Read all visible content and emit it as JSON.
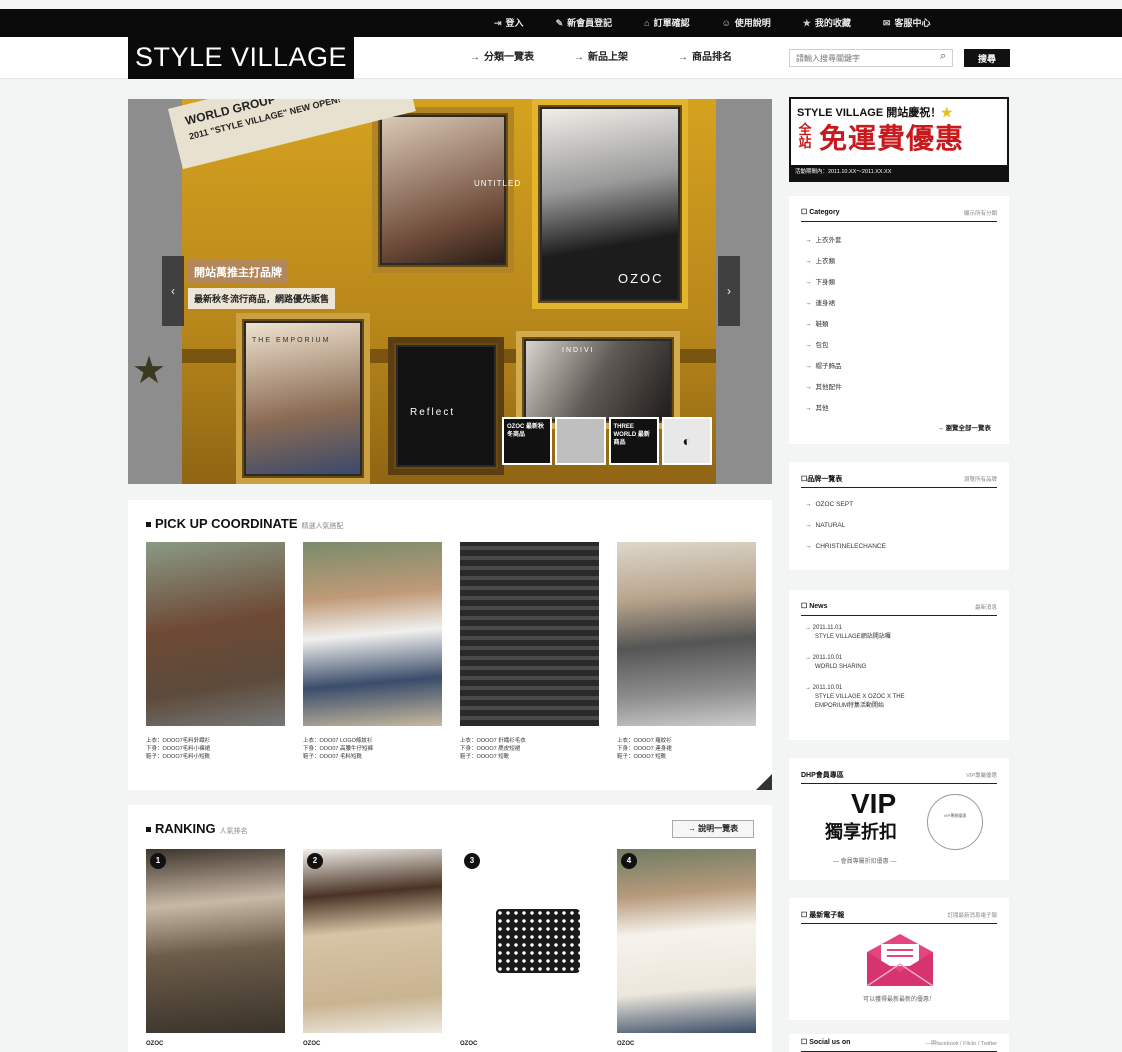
{
  "topnav": [
    {
      "icon": "login-icon",
      "glyph": "⇥",
      "label": "登入"
    },
    {
      "icon": "edit-icon",
      "glyph": "✎",
      "label": "新會員登記"
    },
    {
      "icon": "cart-icon",
      "glyph": "⌂",
      "label": "訂單確認"
    },
    {
      "icon": "help-icon",
      "glyph": "☺",
      "label": "使用說明"
    },
    {
      "icon": "star-icon",
      "glyph": "★",
      "label": "我的收藏"
    },
    {
      "icon": "mail-icon",
      "glyph": "✉",
      "label": "客服中心"
    }
  ],
  "header": {
    "logo": "STYLE VILLAGE",
    "nav": [
      {
        "label": "分類一覽表"
      },
      {
        "label": "新品上架"
      },
      {
        "label": "商品排名"
      }
    ],
    "search_placeholder": "請輸入搜尋關鍵字",
    "search_button": "搜尋"
  },
  "hero": {
    "tape_line1": "WORLD GROUP",
    "tape_line2": "2011 \"STYLE VILLAGE\" NEW OPEN!",
    "caption1": "開站萬推主打品牌",
    "caption2": "最新秋冬流行商品，網路優先販售",
    "frame_labels": [
      "UNTITLED",
      "OZOC",
      "THE EMPORIUM",
      "Reflect",
      "INDIVI"
    ],
    "brand_tiles": [
      "OZOC 最新秋冬商品",
      "",
      "THREE WORLD 最新商品",
      "◐"
    ]
  },
  "pickup": {
    "title": "PICK UP COORDINATE",
    "subtitle": "精選人氣搭配",
    "items": [
      {
        "lines": [
          "上衣：OOOO7毛料針織衫",
          "下身：OOOO7毛料小褲裙",
          "鞋子：OOOO7毛料小短靴"
        ]
      },
      {
        "lines": [
          "上衣：OOO07 LOGO條紋衫",
          "下身：OOO07 高腰牛仔短褲",
          "鞋子：OOO07 毛料短靴"
        ]
      },
      {
        "lines": [
          "上衣：OOOO7 針織衫毛衣",
          "下身：OOOO7 麂皮短裙",
          "鞋子：OOOO7 短靴"
        ]
      },
      {
        "lines": [
          "上衣：OOOO7 羅紋衫",
          "下身：OOOO7 連身裙",
          "鞋子：OOOO7 短靴"
        ]
      }
    ]
  },
  "ranking": {
    "title": "RANKING",
    "subtitle": "人氣排名",
    "more": "→ 說明一覽表",
    "items": [
      {
        "num": "1",
        "brand": "OZOC"
      },
      {
        "num": "2",
        "brand": "OZOC"
      },
      {
        "num": "3",
        "brand": "OZOC"
      },
      {
        "num": "4",
        "brand": "OZOC"
      }
    ]
  },
  "promo": {
    "line1": "STYLE VILLAGE 開站慶祝！",
    "line2a": "全站",
    "line2b": "免運費優惠",
    "line3": "活動期間內：2011.10.XX～2011.XX.XX"
  },
  "category": {
    "title": "☐ Category",
    "sub": "顯示所有分類",
    "items": [
      "上衣外套",
      "上衣類",
      "下身類",
      "連身裙",
      "鞋類",
      "包包",
      "帽子飾品",
      "其他配件",
      "其他"
    ],
    "more": "→ 瀏覽全部一覽表"
  },
  "brands": {
    "title": "☐品牌一覽表",
    "sub": "瀏覽所有品牌",
    "items": [
      "OZOC SEPT",
      "NATURAL",
      "CHRISTINELECHANCE"
    ]
  },
  "news": {
    "title": "☐ News",
    "sub": "最新消息",
    "items": [
      {
        "date": "2011.11.01",
        "text": "STYLE VILLAGE網站開站囉"
      },
      {
        "date": "2011.10.01",
        "text": "WORLD SHARING"
      },
      {
        "date": "2011.10.01",
        "text": "STYLE VILLAGE X OZOC X THE",
        "text2": "EMPORIUM特集活動開始"
      }
    ]
  },
  "vip": {
    "title": "DHP會員專區",
    "sub": "VIP專屬優惠",
    "big": "VIP",
    "zh": "獨享折扣",
    "circle": "VIP專屬優惠",
    "foot": "— 會員專屬折扣優惠 —"
  },
  "newsletter": {
    "title": "☐ 最新電子報",
    "sub": "訂閱最新消息電子報",
    "caption": "可以獲得最新最新的優惠！"
  },
  "social": {
    "title": "☐ Social us on",
    "sub": "—與facebook / Flickr / Twitter"
  },
  "colors": {
    "accent": "#c8191d",
    "envelope": "#e4457f"
  }
}
